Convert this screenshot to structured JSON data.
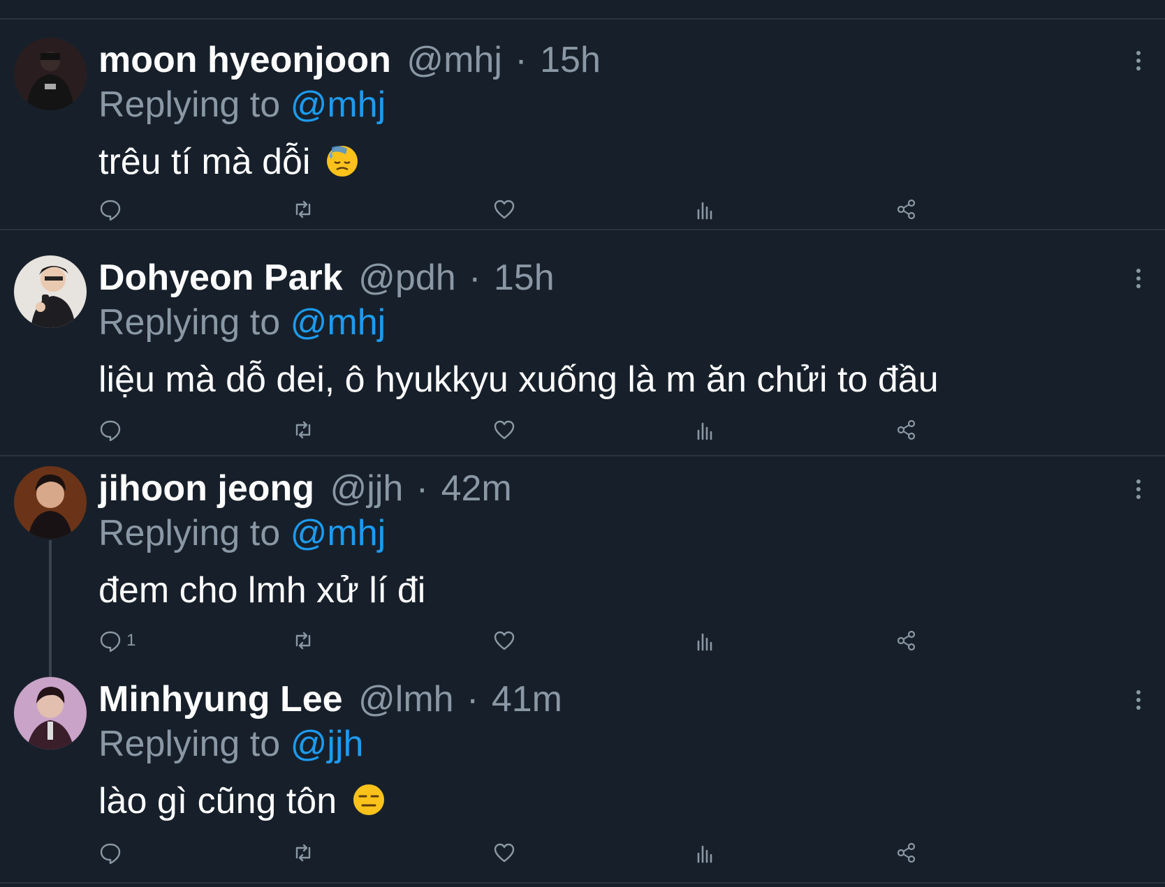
{
  "tweets": [
    {
      "name": "moon hyeonjoon",
      "handle": "@mhj",
      "time": "15h",
      "reply_prefix": "Replying to",
      "reply_to": "@mhj",
      "text": "trêu tí mà dỗi",
      "emoji": "downcast-sweat-face",
      "reply_count": ""
    },
    {
      "name": "Dohyeon Park",
      "handle": "@pdh",
      "time": "15h",
      "reply_prefix": "Replying to",
      "reply_to": "@mhj",
      "text": "liệu mà dỗ dei, ô hyukkyu xuống là m ăn chửi to đầu",
      "emoji": "",
      "reply_count": ""
    },
    {
      "name": "jihoon jeong",
      "handle": "@jjh",
      "time": "42m",
      "reply_prefix": "Replying to",
      "reply_to": "@mhj",
      "text": "đem cho lmh xử lí đi",
      "emoji": "",
      "reply_count": "1"
    },
    {
      "name": "Minhyung Lee",
      "handle": "@lmh",
      "time": "41m",
      "reply_prefix": "Replying to",
      "reply_to": "@jjh",
      "text": "lào gì cũng tôn",
      "emoji": "expressionless-face",
      "reply_count": ""
    }
  ],
  "colors": {
    "background": "#17202a",
    "separator": "#2a333c",
    "secondary_text": "#8a98a5",
    "mention": "#1d9bf0"
  },
  "icons": [
    "reply-icon",
    "retweet-icon",
    "like-icon",
    "views-icon",
    "share-icon",
    "more-icon"
  ],
  "meta_separator": "·"
}
